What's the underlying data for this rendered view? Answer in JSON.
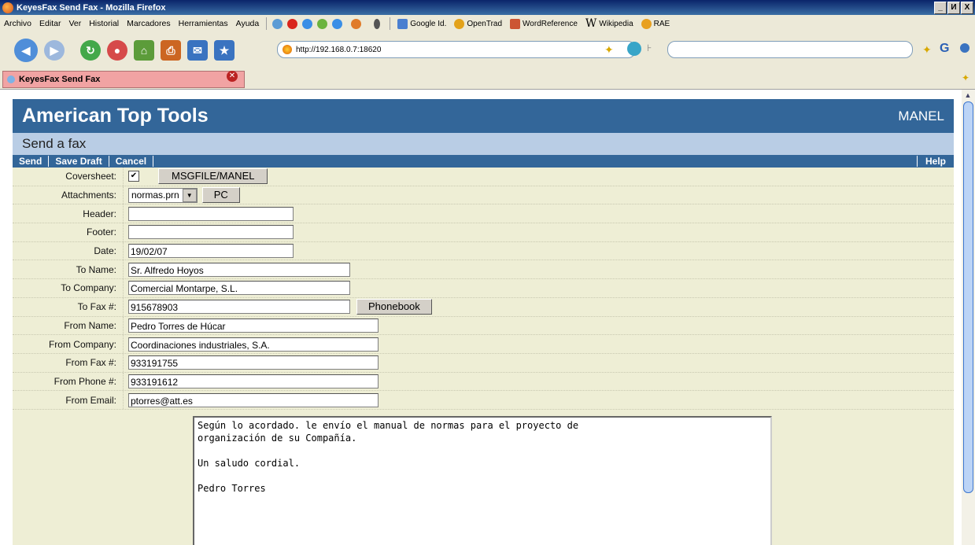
{
  "window": {
    "title": "KeyesFax Send Fax - Mozilla Firefox",
    "controls": [
      "_",
      "И",
      "X"
    ]
  },
  "menu": [
    "Archivo",
    "Editar",
    "Ver",
    "Historial",
    "Marcadores",
    "Herramientas",
    "Ayuda"
  ],
  "bookmarks": [
    "Google Id.",
    "OpenTrad",
    "WordReference",
    "Wikipedia",
    "RAE"
  ],
  "nav": {
    "url": "http://192.168.0.7:18620"
  },
  "tab": {
    "label": "KeyesFax Send Fax"
  },
  "app": {
    "brand": "American Top Tools",
    "user": "MANEL",
    "subtitle": "Send a fax",
    "actions": {
      "send": "Send",
      "save_draft": "Save Draft",
      "cancel": "Cancel",
      "help": "Help"
    },
    "form": {
      "coversheet": {
        "label": "Coversheet:",
        "checked": "✔",
        "button": "MSGFILE/MANEL"
      },
      "attachments": {
        "label": "Attachments:",
        "value": "normas.prn",
        "button": "PC"
      },
      "header": {
        "label": "Header:",
        "value": ""
      },
      "footer": {
        "label": "Footer:",
        "value": ""
      },
      "date": {
        "label": "Date:",
        "value": "19/02/07"
      },
      "to_name": {
        "label": "To Name:",
        "value": "Sr. Alfredo Hoyos"
      },
      "to_company": {
        "label": "To Company:",
        "value": "Comercial Montarpe, S.L."
      },
      "to_fax": {
        "label": "To Fax #:",
        "value": "915678903",
        "button": "Phonebook"
      },
      "from_name": {
        "label": "From Name:",
        "value": "Pedro Torres de Húcar"
      },
      "from_company": {
        "label": "From Company:",
        "value": "Coordinaciones industriales, S.A."
      },
      "from_fax": {
        "label": "From Fax #:",
        "value": "933191755"
      },
      "from_phone": {
        "label": "From Phone #:",
        "value": "933191612"
      },
      "from_email": {
        "label": "From Email:",
        "value": "ptorres@att.es"
      },
      "message": "Según lo acordado. le envío el manual de normas para el proyecto de\norganización de su Compañía.\n\nUn saludo cordial.\n\nPedro Torres"
    }
  }
}
